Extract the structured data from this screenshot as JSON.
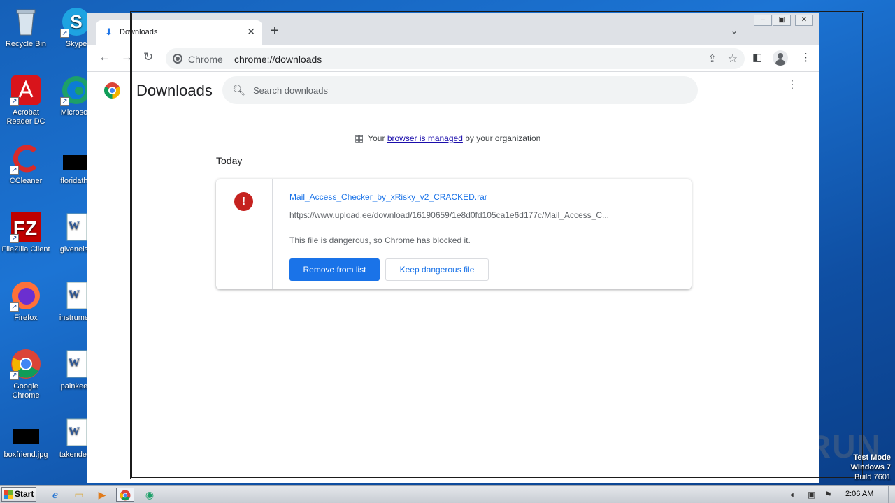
{
  "desktop": {
    "icons": [
      {
        "label": "Recycle Bin",
        "icon": "recycle-bin-icon"
      },
      {
        "label": "Skype",
        "icon": "skype-icon"
      },
      {
        "label": "Acrobat Reader DC",
        "icon": "acrobat-icon"
      },
      {
        "label": "Microsoft",
        "icon": "edge-icon"
      },
      {
        "label": "CCleaner",
        "icon": "ccleaner-icon"
      },
      {
        "label": "floridathu",
        "icon": "image-file-icon"
      },
      {
        "label": "FileZilla Client",
        "icon": "filezilla-icon"
      },
      {
        "label": "givenelse",
        "icon": "word-doc-icon"
      },
      {
        "label": "Firefox",
        "icon": "firefox-icon"
      },
      {
        "label": "instrumen",
        "icon": "word-doc-icon"
      },
      {
        "label": "Google Chrome",
        "icon": "chrome-icon"
      },
      {
        "label": "painkeep",
        "icon": "word-doc-icon"
      },
      {
        "label": "boxfriend.jpg",
        "icon": "image-file-icon"
      },
      {
        "label": "takendeta",
        "icon": "word-doc-icon"
      }
    ]
  },
  "browser": {
    "tab": {
      "title": "Downloads",
      "icon": "download-icon"
    },
    "toolbar": {
      "scheme_label": "Chrome",
      "url": "chrome://downloads"
    }
  },
  "page": {
    "title": "Downloads",
    "search_placeholder": "Search downloads",
    "managed_prefix": "Your",
    "managed_link": "browser is managed",
    "managed_suffix": "by your organization",
    "section": "Today",
    "download": {
      "file_name": "Mail_Access_Checker_by_xRisky_v2_CRACKED.rar",
      "url": "https://www.upload.ee/download/16190659/1e8d0fd105ca1e6d177c/Mail_Access_C...",
      "status": "This file is dangerous, so Chrome has blocked it.",
      "remove_label": "Remove from list",
      "keep_label": "Keep dangerous file",
      "status_color": "#c5221f"
    }
  },
  "watermark": {
    "anyrun": "ANY RUN",
    "test_mode_line1": "Test Mode",
    "test_mode_line2": "Windows 7",
    "test_mode_line3": "Build 7601"
  },
  "taskbar": {
    "start_label": "Start",
    "clock": "2:06 AM"
  }
}
